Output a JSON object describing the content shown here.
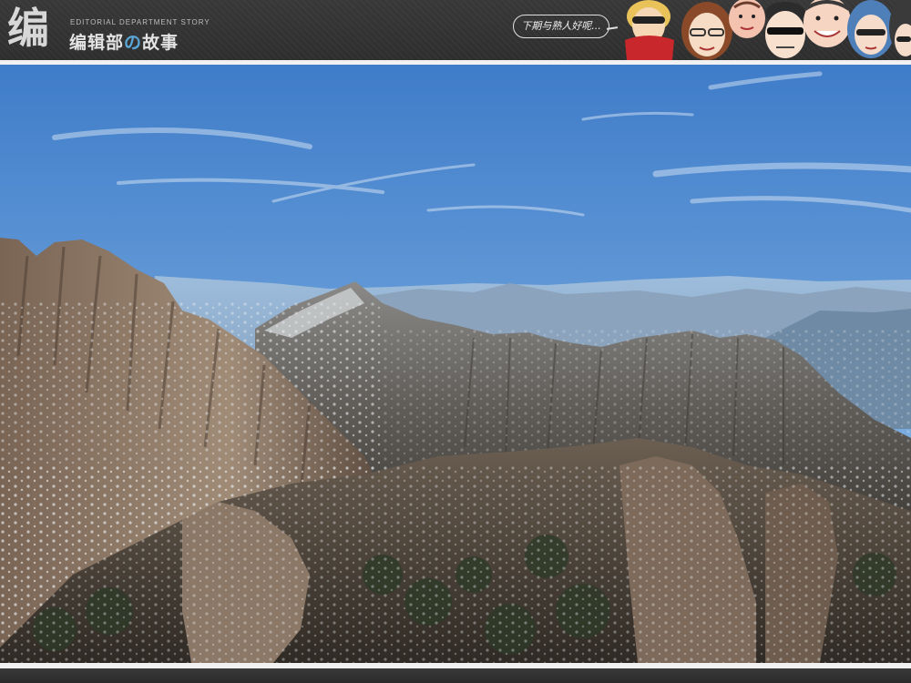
{
  "header": {
    "logo_glyph": "编",
    "brand_en": "EDITORIAL DEPARTMENT STORY",
    "brand_cn_a": "编辑部",
    "brand_cn_b": "の",
    "brand_cn_c": "故事",
    "speech_bubble": "下期与熟人好呢..."
  },
  "colors": {
    "header_bg": "#333333",
    "accent_blue": "#5aa7d8",
    "divider": "#f1f1f1"
  },
  "photo": {
    "subject": "snowy-granite-mountain-landscape"
  }
}
